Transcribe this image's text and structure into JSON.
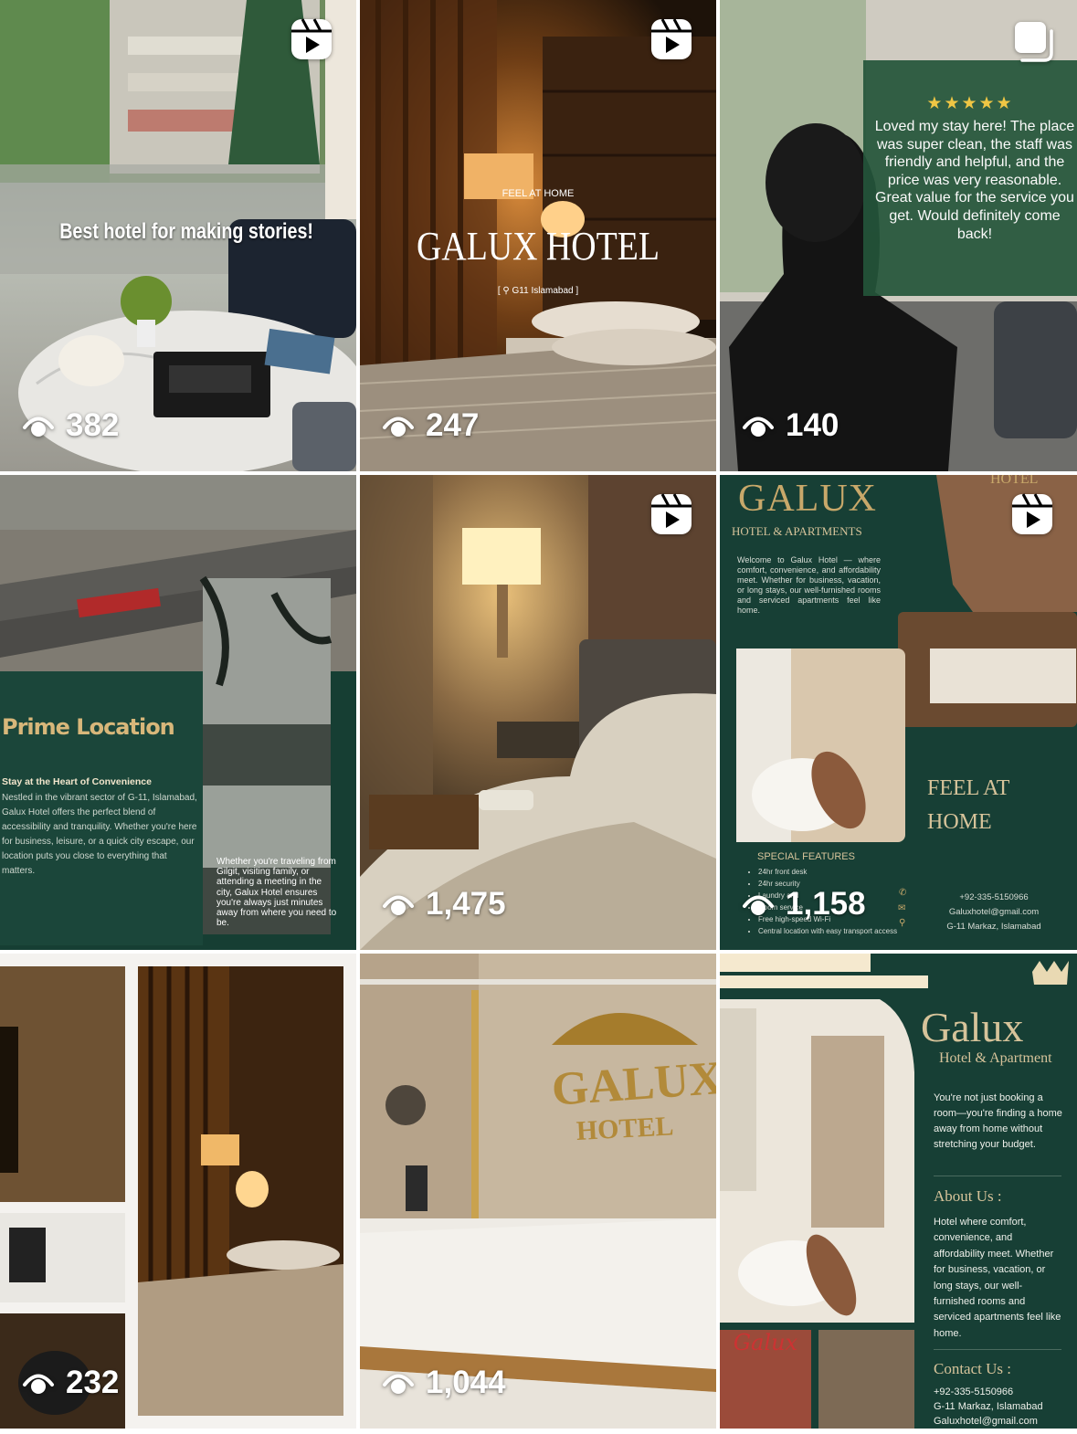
{
  "grid": {
    "posts": [
      {
        "views": "382",
        "type_icon": "reel-icon",
        "overlay_text": "Best hotel for making stories!"
      },
      {
        "views": "247",
        "type_icon": "reel-icon",
        "eyebrow": "FEEL AT HOME",
        "title": "GALUX HOTEL",
        "location": "[ ⚲ G11 Islamabad ]"
      },
      {
        "views": "140",
        "type_icon": "carousel-icon",
        "stars": "★★★★★",
        "review": "Loved my stay here! The place was super clean, the staff was friendly and helpful, and the price was very reasonable. Great value for the service you get. Would definitely come back!"
      },
      {
        "heading": "Prime Location",
        "subheading": "Stay at the Heart of Convenience",
        "body": "Nestled in the vibrant sector of G-11, Islamabad, Galux Hotel offers the perfect blend of accessibility and tranquility. Whether you're here for business, leisure, or a quick city escape, our location puts you close to everything that matters.",
        "side_text": "Whether you're traveling from Gilgit, visiting family, or attending a meeting in the city, Galux Hotel ensures you're always just minutes away from where you need to be."
      },
      {
        "views": "1,475",
        "type_icon": "reel-icon"
      },
      {
        "views": "1,158",
        "type_icon": "reel-icon",
        "brand": "GALUX",
        "brand_sub": "HOTEL & APARTMENTS",
        "corner_text": "HOTEL",
        "intro": "Welcome to Galux Hotel — where comfort, convenience, and affordability meet. Whether for business, vacation, or long stays, our well-furnished rooms and serviced apartments feel like home.",
        "tagline": "FEEL AT HOME",
        "features_title": "SPECIAL FEATURES",
        "features": [
          "24hr front desk",
          "24hr security",
          "Laundry and",
          "Room service",
          "Free high-speed Wi-Fi",
          "Central location with easy transport access"
        ],
        "phone": "+92-335-5150966",
        "email": "Galuxhotel@gmail.com",
        "address": "G-11 Markaz, Islamabad"
      },
      {
        "views": "232"
      },
      {
        "views": "1,044",
        "sign_line1": "GALUX",
        "sign_line2": "HOTEL"
      },
      {
        "brand": "Galux",
        "brand_sub": "Hotel & Apartment",
        "intro": "You're not just booking a room—you're finding a home away from home without stretching your budget.",
        "about_title": "About Us :",
        "about_body": "Hotel where comfort, convenience, and affordability meet. Whether for business, vacation, or long stays, our well-furnished rooms and serviced apartments feel like home.",
        "contact_title": "Contact Us :",
        "phone": "+92-335-5150966",
        "address": "G-11 Markaz, Islamabad",
        "email": "Galuxhotel@gmail.com",
        "sign_text": "Galux"
      }
    ]
  },
  "colors": {
    "green": "#173f35",
    "gold": "#c8a86a",
    "cream": "#f5e9cf"
  }
}
